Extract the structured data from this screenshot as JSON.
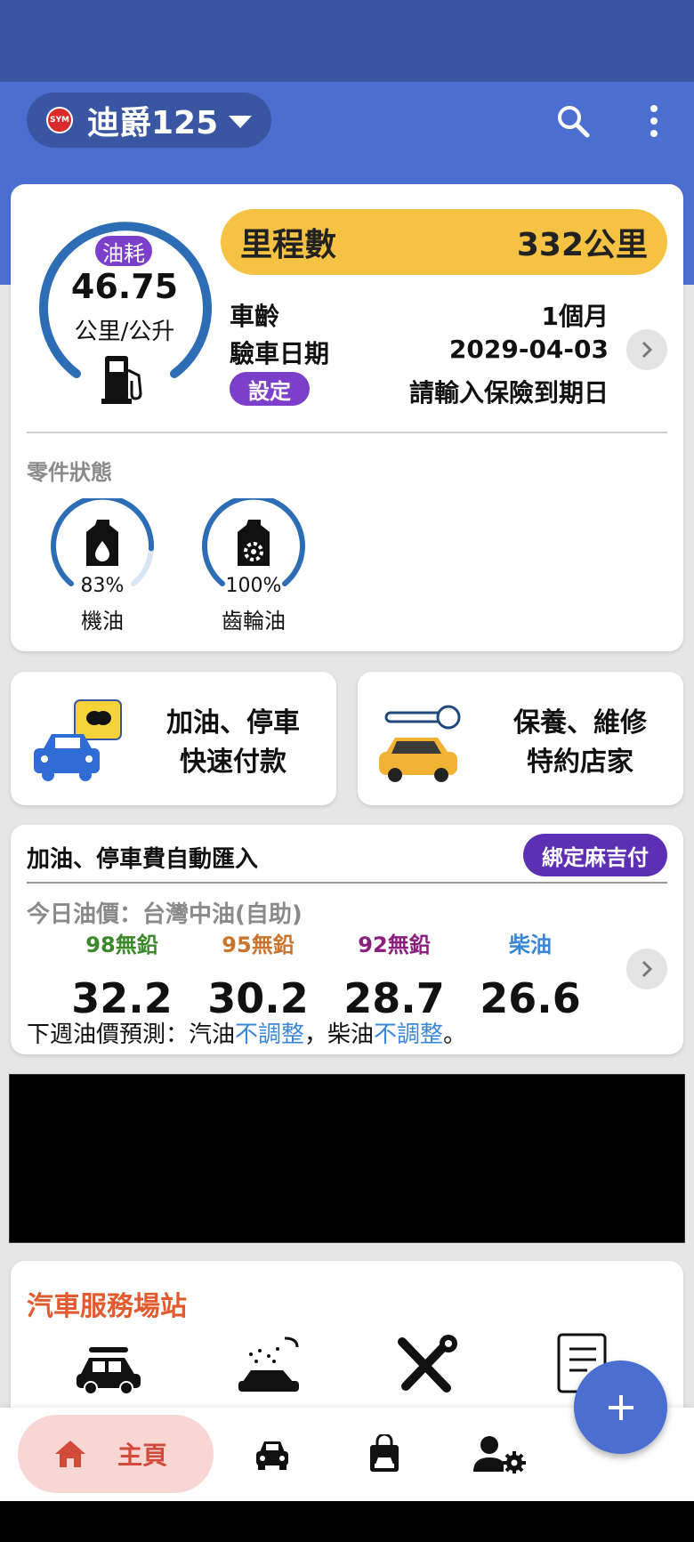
{
  "header": {
    "brand_logo_text": "SYM",
    "car_name": "迪爵125"
  },
  "summary": {
    "fuel_label": "油耗",
    "fuel_value": "46.75",
    "fuel_unit": "公里/公升",
    "mileage_label": "里程數",
    "mileage_value": "332公里",
    "vehicle_age_label": "車齡",
    "vehicle_age_value": "1個月",
    "inspection_label": "驗車日期",
    "inspection_value": "2029-04-03",
    "set_button": "設定",
    "insurance_prompt": "請輸入保險到期日"
  },
  "parts": {
    "title": "零件狀態",
    "items": [
      {
        "name": "機油",
        "percent": "83%",
        "level": 0.83
      },
      {
        "name": "齒輪油",
        "percent": "100%",
        "level": 1.0
      }
    ]
  },
  "tiles": [
    {
      "line1": "加油、停車",
      "line2": "快速付款"
    },
    {
      "line1": "保養、維修",
      "line2": "特約店家"
    }
  ],
  "fuel_prices": {
    "title": "加油、停車費自動匯入",
    "bind_button": "綁定麻吉付",
    "today_label": "今日油價：台灣中油(自助)",
    "items": [
      {
        "type": "98無鉛",
        "price": "32.2",
        "color": "#3a8a2a"
      },
      {
        "type": "95無鉛",
        "price": "30.2",
        "color": "#c9752e"
      },
      {
        "type": "92無鉛",
        "price": "28.7",
        "color": "#8b1f7d"
      },
      {
        "type": "柴油",
        "price": "26.6",
        "color": "#3a86d8"
      }
    ],
    "forecast_prefix": "下週油價預測：汽油",
    "forecast_gas": "不調整",
    "forecast_mid": "，柴油",
    "forecast_diesel": "不調整",
    "forecast_suffix": "。"
  },
  "services": {
    "title": "汽車服務場站"
  },
  "nav": {
    "home_label": "主頁"
  },
  "colors": {
    "primary": "#4a6fd0",
    "primary_dark": "#3a56a2",
    "accent_purple": "#7c3fc9",
    "mileage_yellow": "#f5c244",
    "service_orange": "#e35a2e"
  }
}
